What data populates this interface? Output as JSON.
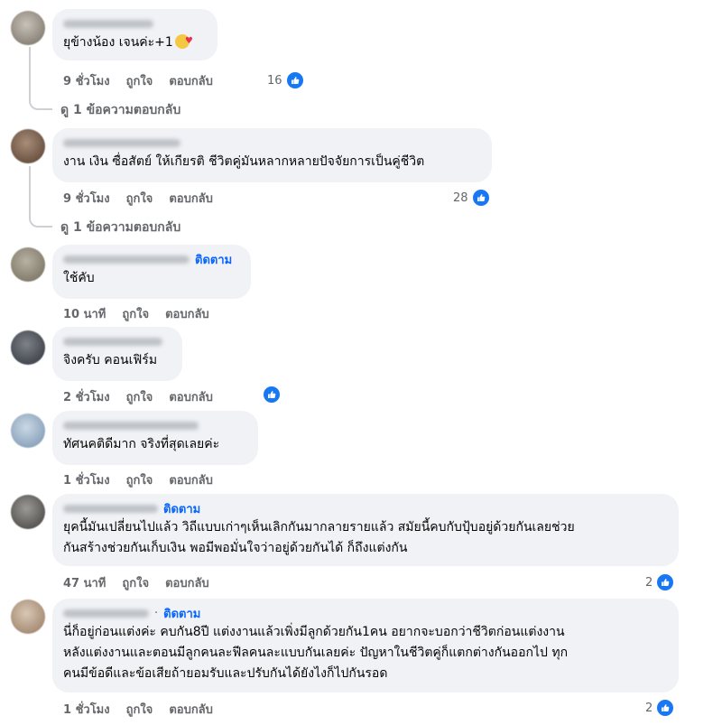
{
  "labels": {
    "like": "ถูกใจ",
    "reply": "ตอบกลับ",
    "follow": "ติดตาม",
    "dot": "·"
  },
  "comments": [
    {
      "text": "ยุข้างน้อง เจนค่ะ+1",
      "time": "9 ชั่วโมง",
      "reactions": "16",
      "view_replies": "ดู 1 ข้อความตอบกลับ"
    },
    {
      "text": "งาน เงิน ซื่อสัตย์ ให้เกียรติ ชีวิตคู่มันหลากหลายปัจจัยการเป็นคู่ชีวิต",
      "time": "9 ชั่วโมง",
      "reactions": "28",
      "view_replies": "ดู 1 ข้อความตอบกลับ"
    },
    {
      "text": "ใช้คับ",
      "time": "10 นาที",
      "show_follow": true
    },
    {
      "text": "จิงครับ คอนเฟิร์ม",
      "time": "2 ชั่วโมง"
    },
    {
      "text": "ทัศนคติดีมาก จริงที่สุดเลยค่ะ",
      "time": "1 ชั่วโมง"
    },
    {
      "text_lines": [
        "ยุคนี้มันเปลี่ยนไปแล้ว วิถีแบบเก่าๆเห็นเลิกกันมากลายรายแล้ว สมัยนี้คบกับปุ้บอยู่ด้วยกันเลยช่วย",
        "กันสร้างช่วยกันเก็บเงิน พอมีพอมั่นใจว่าอยู่ด้วยกันได้ ก็ถึงแต่งกัน"
      ],
      "time": "47 นาที",
      "reactions": "2",
      "show_follow": true
    },
    {
      "text_lines": [
        "นี่ก็อยู่ก่อนแต่งค่ะ คบกัน8ปี แต่งงานแล้วเพิ่งมีลูกด้วยกัน1คน อยากจะบอกว่าชีวิตก่อนแต่งงาน",
        "หลังแต่งงานและตอนมีลูกคนละฟีลคนละแบบกันเลยค่ะ ปัญหาในชีวิตคู่ก็แตกต่างกันออกไป ทุก",
        "คนมีข้อดีและข้อเสียถ้ายอมรับและปรับกันได้ยังไงก็ไปกันรอด"
      ],
      "time": "1 ชั่วโมง",
      "reactions": "2",
      "show_follow": true
    }
  ],
  "colors": {
    "bubble": "#f0f2f5",
    "muted": "#65676b",
    "accent": "#0866ff",
    "like": "#1877f2"
  },
  "icons": {
    "reaction": "like-thumb-icon",
    "emoji": "smiling-face-with-hearts-icon"
  }
}
